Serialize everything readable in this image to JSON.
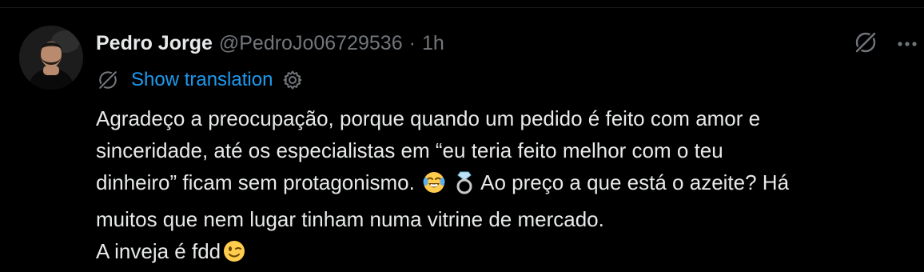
{
  "tweet": {
    "author": {
      "display_name": "Pedro Jorge",
      "handle": "@PedroJo06729536",
      "separator": "·",
      "time": "1h"
    },
    "translate": {
      "label": "Show translation"
    },
    "text_lines": [
      "Agradeço a preocupação, porque quando um pedido é feito com amor e",
      "sinceridade, até os especialistas em “eu teria feito melhor com o teu",
      "dinheiro” ficam sem protagonismo.",
      "Ao preço a que está o azeite? Há",
      "muitos que nem lugar tinham numa vitrine de mercado.",
      "A inveja é fdd"
    ],
    "emojis": [
      "face-with-tears-of-joy-icon",
      "ring-icon",
      "winking-face-icon"
    ],
    "icons": {
      "grok": "grok-icon",
      "more": "more-options-icon",
      "settings": "gear-icon"
    },
    "colors": {
      "background": "#000000",
      "primary_text": "#e7e9ea",
      "secondary_text": "#71767b",
      "link": "#1d9bf0"
    }
  }
}
